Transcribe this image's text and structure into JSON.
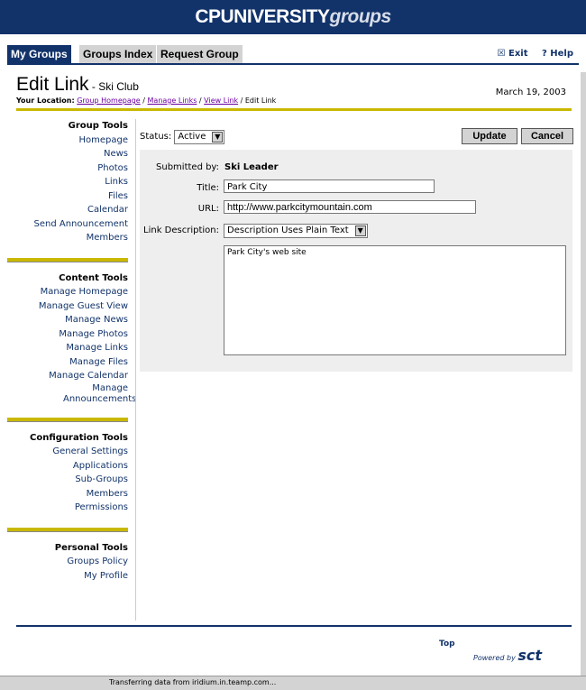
{
  "banner": {
    "main": "CPUNIVERSITY",
    "accent": "groups"
  },
  "tabs": [
    {
      "label": "My Groups"
    },
    {
      "label": "Groups Index"
    },
    {
      "label": "Request Group"
    }
  ],
  "toplinks": {
    "exit": "☒ Exit",
    "help": "? Help"
  },
  "page": {
    "title": "Edit Link",
    "subtitle": " - Ski Club",
    "date": "March 19, 2003"
  },
  "location": {
    "label": "Your Location:",
    "crumbs": [
      "Group Homepage",
      "Manage Links",
      "View Link"
    ],
    "current": "Edit Link"
  },
  "sidebar": {
    "group_tools": {
      "header": "Group Tools",
      "items": [
        "Homepage",
        "News",
        "Photos",
        "Links",
        "Files",
        "Calendar",
        "Send Announcement",
        "Members"
      ]
    },
    "content_tools": {
      "header": "Content Tools",
      "items": [
        "Manage Homepage",
        "Manage Guest View",
        "Manage News",
        "Manage Photos",
        "Manage Links",
        "Manage Files",
        "Manage Calendar",
        "Manage Announcements"
      ]
    },
    "config_tools": {
      "header": "Configuration Tools",
      "items": [
        "General Settings",
        "Applications",
        "Sub-Groups",
        "Members",
        "Permissions"
      ]
    },
    "personal_tools": {
      "header": "Personal Tools",
      "items": [
        "Groups Policy",
        "My Profile"
      ]
    }
  },
  "form": {
    "status_label": "Status:",
    "status_value": "Active",
    "update": "Update",
    "cancel": "Cancel",
    "submitted_label": "Submitted by:",
    "submitted_value": "Ski Leader",
    "title_label": "Title:",
    "title_value": "Park City",
    "url_label": "URL:",
    "url_value": "http://www.parkcitymountain.com",
    "desc_label": "Link Description:",
    "desc_mode": "Description Uses Plain Text",
    "desc_value": "Park City's web site"
  },
  "footer": {
    "top": "Top",
    "powered": "Powered by",
    "brand": "sct"
  },
  "statusbar": {
    "message": "Transferring data from iridium.in.teamp.com..."
  }
}
